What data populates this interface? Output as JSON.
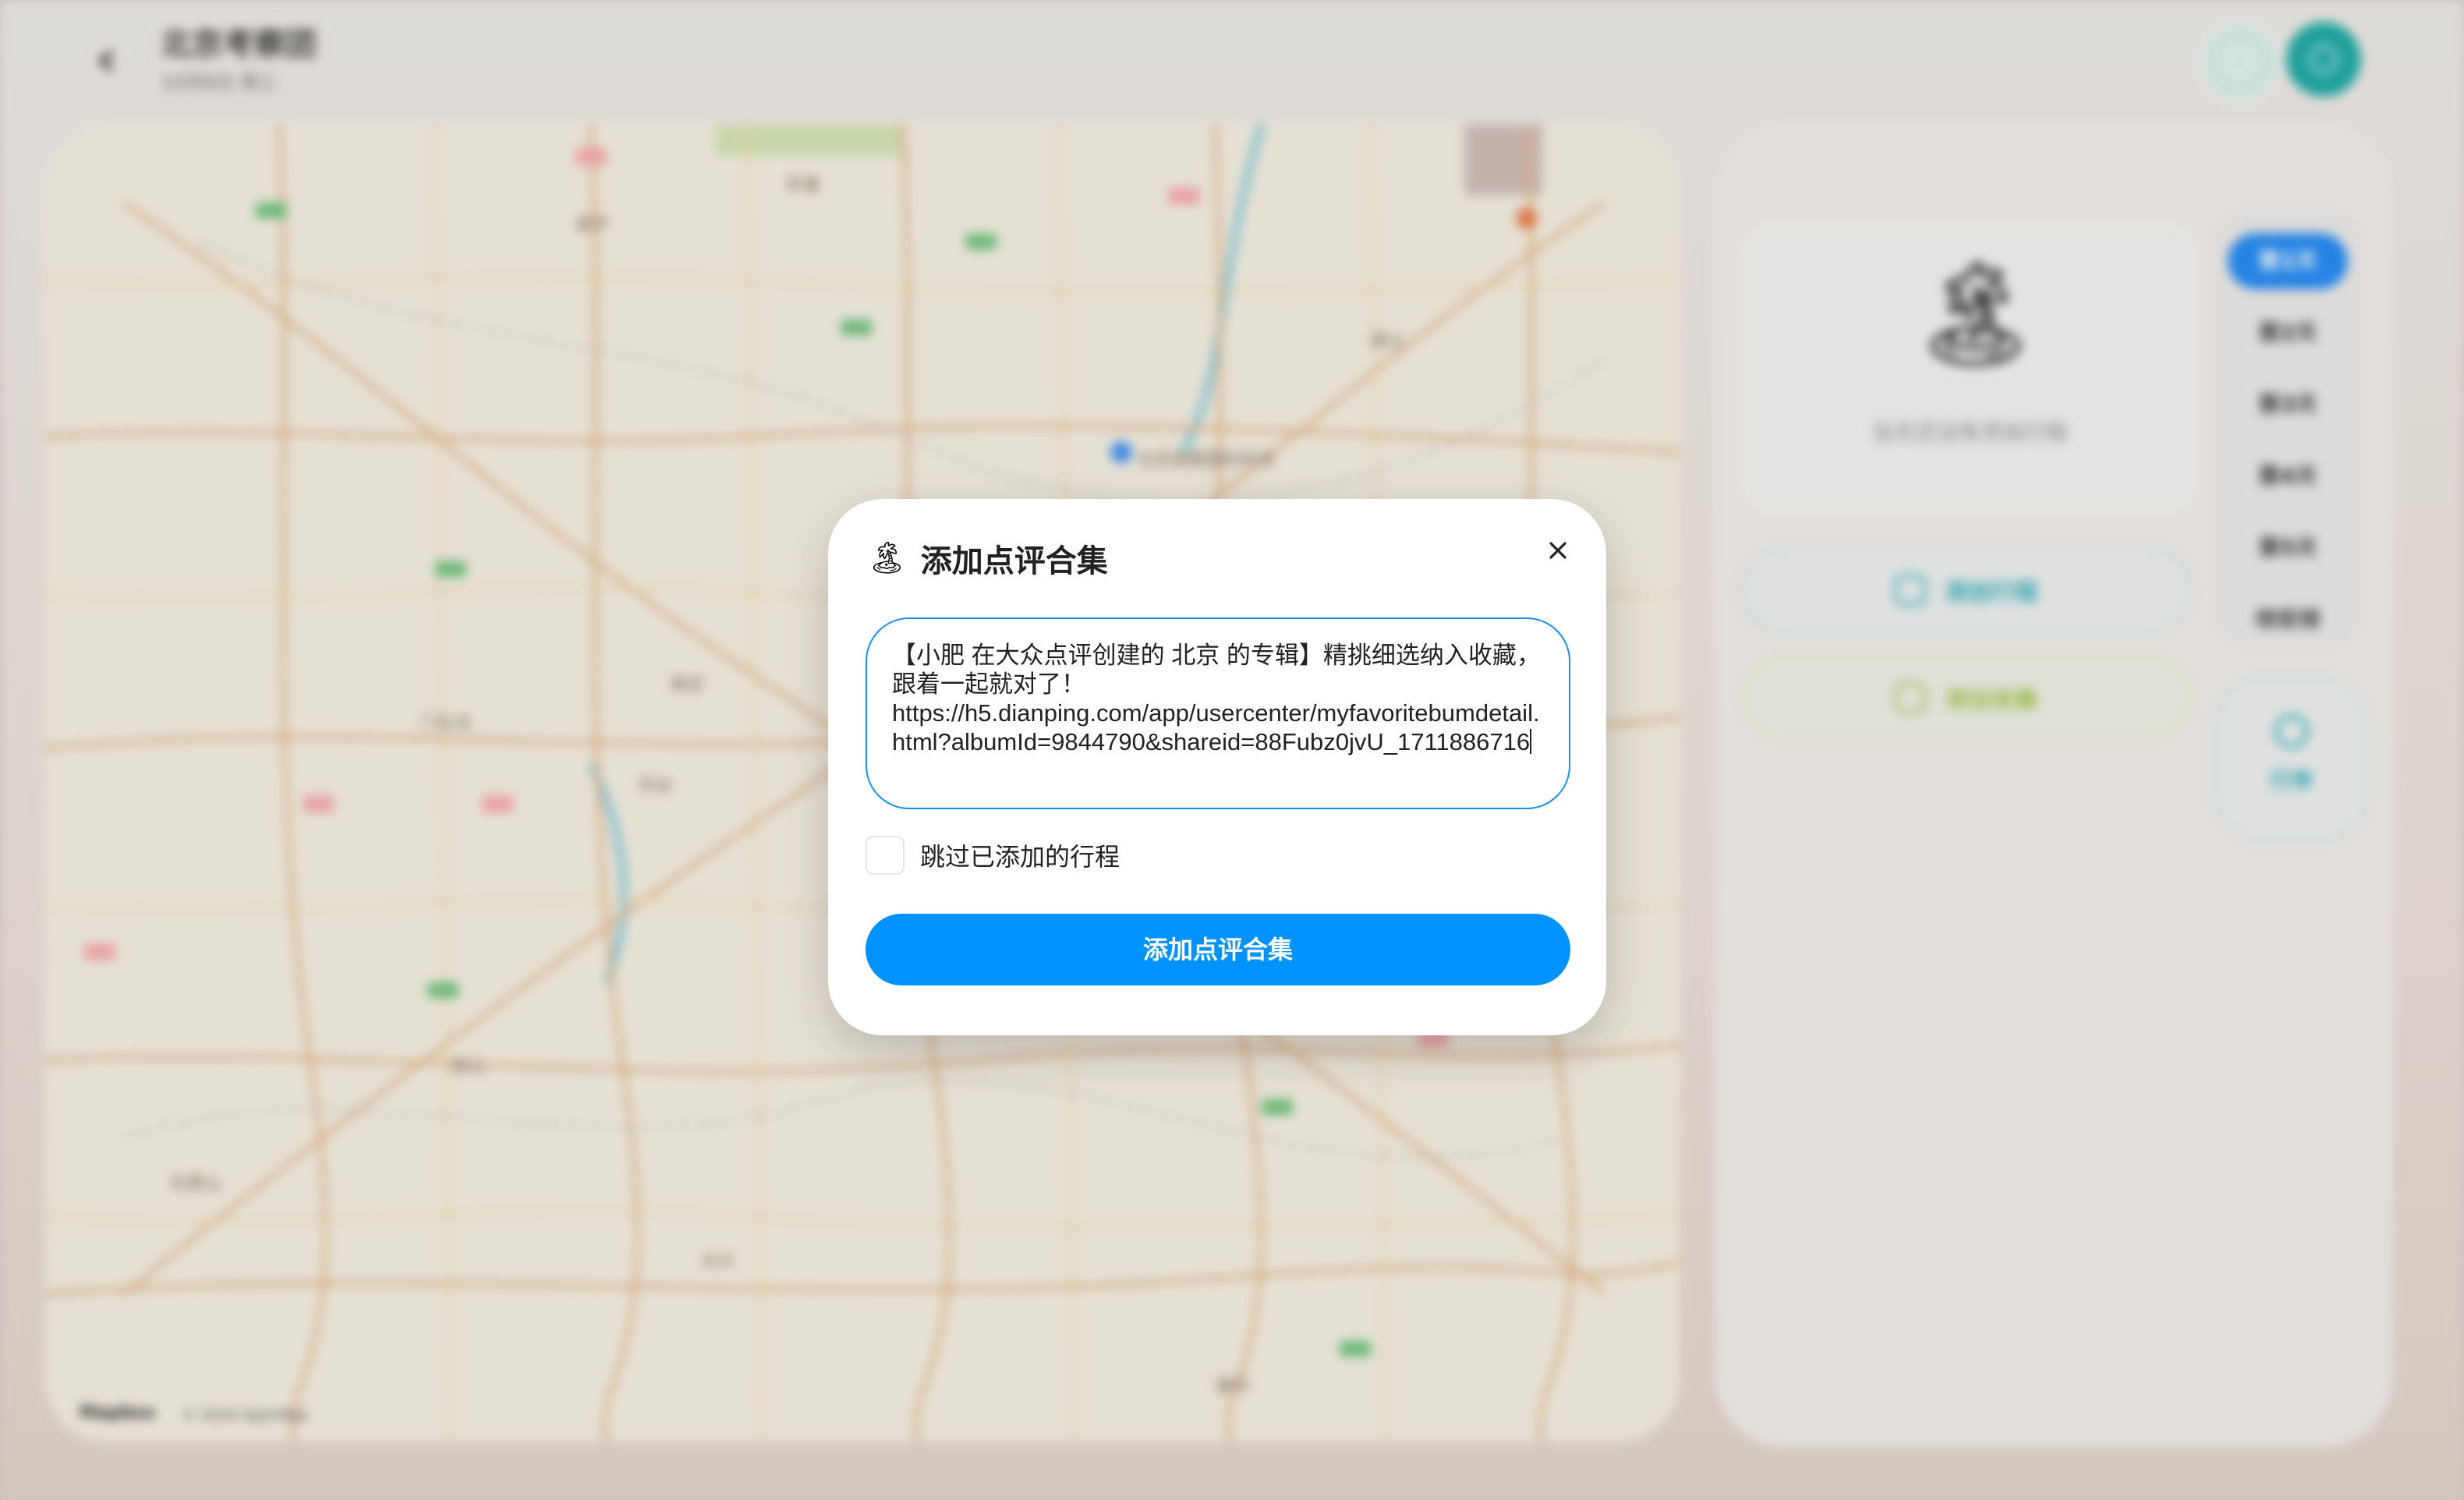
{
  "header": {
    "title": "北京考察团",
    "subtitle": "10月8日 周三"
  },
  "map": {
    "attribution_logo": "Mapbox",
    "attribution_text": "© 2024 OpenMap",
    "labels": [
      "怀柔",
      "昌平",
      "北京首都国际机场",
      "门头沟",
      "海淀",
      "朝阳",
      "房山",
      "大兴",
      "通州",
      "顺义",
      "丰台",
      "石景山"
    ]
  },
  "sidebar": {
    "empty_text": "当天还没有添加行程",
    "add_itinerary_label": "添加行程",
    "add_collection_label": "添加收集",
    "days": [
      "第1天",
      "第2天",
      "第3天",
      "第4天",
      "第5天",
      "待安排"
    ],
    "active_day_index": 0,
    "itinerary_button_label": "行李"
  },
  "modal": {
    "title": "添加点评合集",
    "textarea_value": "【小肥 在大众点评创建的 北京 的专辑】精挑细选纳入收藏，跟着一起就对了！\nhttps://h5.dianping.com/app/usercenter/myfavoritebumdetail.html?albumId=9844790&shareid=88Fubz0jvU_1711886716",
    "checkbox_label": "跳过已添加的行程",
    "checkbox_checked": false,
    "submit_label": "添加点评合集"
  },
  "colors": {
    "primary": "#0093ff",
    "input_border": "#1a90f0",
    "teal": "#1aa6a3"
  },
  "icons": {
    "title_icon": "palm-tree-icon",
    "close": "close-icon",
    "back": "back-arrow-icon"
  }
}
